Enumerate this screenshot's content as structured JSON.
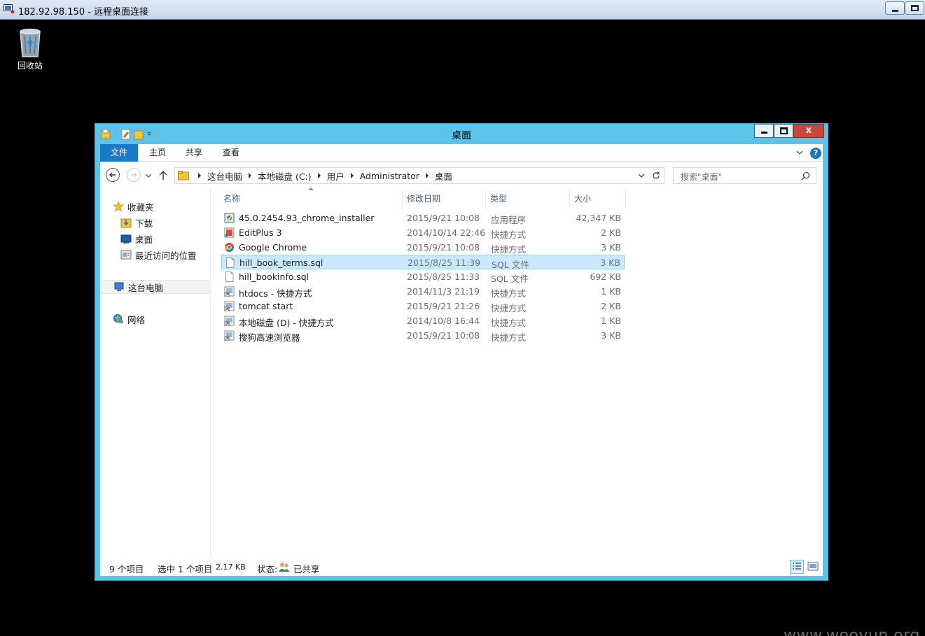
{
  "rdp": {
    "title": "182.92.98.150 - 远程桌面连接"
  },
  "desktop": {
    "recycle_bin_label": "回收站",
    "watermark": "www.wooyun.org"
  },
  "explorer": {
    "title": "桌面",
    "ribbon": {
      "file": "文件",
      "home": "主页",
      "share": "共享",
      "view": "查看"
    },
    "breadcrumbs": [
      "这台电脑",
      "本地磁盘 (C:)",
      "用户",
      "Administrator",
      "桌面"
    ],
    "search_placeholder": "搜索\"桌面\"",
    "nav_pane": {
      "favorites": "收藏夹",
      "downloads": "下载",
      "desktop": "桌面",
      "recent": "最近访问的位置",
      "this_pc": "这台电脑",
      "network": "网络"
    },
    "columns": {
      "name": "名称",
      "date": "修改日期",
      "type": "类型",
      "size": "大小"
    },
    "files": [
      {
        "name": "45.0.2454.93_chrome_installer",
        "date": "2015/9/21 10:08",
        "type": "应用程序",
        "size": "42,347 KB",
        "icon": "installer-icon"
      },
      {
        "name": "EditPlus 3",
        "date": "2014/10/14 22:46",
        "type": "快捷方式",
        "size": "2 KB",
        "icon": "editplus-icon"
      },
      {
        "name": "Google Chrome",
        "date": "2015/9/21 10:08",
        "type": "快捷方式",
        "size": "3 KB",
        "icon": "chrome-icon"
      },
      {
        "name": "hill_book_terms.sql",
        "date": "2015/8/25 11:39",
        "type": "SQL 文件",
        "size": "3 KB",
        "icon": "file-icon"
      },
      {
        "name": "hill_bookinfo.sql",
        "date": "2015/8/25 11:33",
        "type": "SQL 文件",
        "size": "692 KB",
        "icon": "file-icon"
      },
      {
        "name": "htdocs - 快捷方式",
        "date": "2014/11/3 21:19",
        "type": "快捷方式",
        "size": "1 KB",
        "icon": "shortcut-icon"
      },
      {
        "name": "tomcat  start",
        "date": "2015/9/21 21:26",
        "type": "快捷方式",
        "size": "2 KB",
        "icon": "shortcut-icon"
      },
      {
        "name": "本地磁盘 (D) - 快捷方式",
        "date": "2014/10/8 16:44",
        "type": "快捷方式",
        "size": "1 KB",
        "icon": "shortcut-icon"
      },
      {
        "name": "搜狗高速浏览器",
        "date": "2015/9/21 10:08",
        "type": "快捷方式",
        "size": "3 KB",
        "icon": "shortcut-icon"
      }
    ],
    "selected_index": 3,
    "status": {
      "item_count": "9 个项目",
      "selected": "选中 1 个项目",
      "selected_size": "2.17 KB",
      "state_label": "状态:",
      "state_value": "已共享"
    },
    "colors": {
      "frame": "#5cc4ea",
      "file_tab": "#1979ca",
      "selection": "#cce8ff",
      "close_button": "#c9463d"
    }
  }
}
